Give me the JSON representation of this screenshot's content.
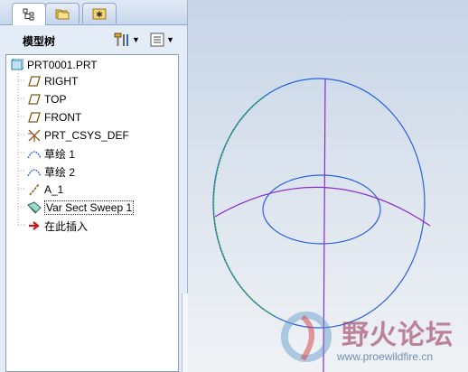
{
  "tree": {
    "title": "模型树",
    "nodes": [
      {
        "label": "PRT0001.PRT",
        "icon": "part-icon"
      },
      {
        "label": "RIGHT",
        "icon": "datum-plane-icon"
      },
      {
        "label": "TOP",
        "icon": "datum-plane-icon"
      },
      {
        "label": "FRONT",
        "icon": "datum-plane-icon"
      },
      {
        "label": "PRT_CSYS_DEF",
        "icon": "coordinate-system-icon"
      },
      {
        "label": "草绘 1",
        "icon": "sketch-icon"
      },
      {
        "label": "草绘 2",
        "icon": "sketch-icon"
      },
      {
        "label": "A_1",
        "icon": "datum-axis-icon"
      },
      {
        "label": "Var Sect Sweep 1",
        "icon": "sweep-feature-icon",
        "selected": true
      },
      {
        "label": "在此插入",
        "icon": "insert-here-arrow-icon"
      }
    ]
  },
  "tabs": [
    {
      "icon": "model-tree-icon",
      "active": true
    },
    {
      "icon": "folder-browser-icon",
      "active": false
    },
    {
      "icon": "favorites-icon",
      "active": false
    }
  ],
  "header_buttons": [
    {
      "icon": "settings-tools-icon"
    },
    {
      "icon": "show-options-icon"
    }
  ],
  "watermark": {
    "text": "野火论坛",
    "url": "www.proewildfire.cn"
  },
  "colors": {
    "panel_bg": "#e4ecf7",
    "sketch_blue": "#2a5fe0",
    "sweep_purple": "#8a2bd0",
    "sketch_green": "#2ab52a"
  }
}
